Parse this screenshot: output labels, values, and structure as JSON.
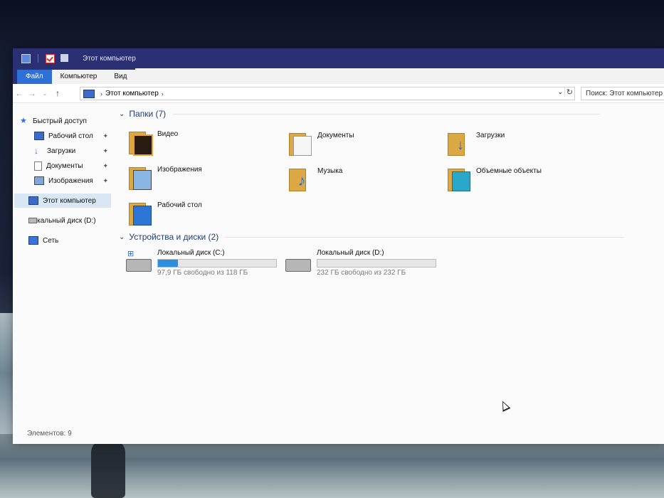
{
  "window": {
    "title": "Этот компьютер"
  },
  "ribbon": {
    "tabs": [
      "Файл",
      "Компьютер",
      "Вид"
    ]
  },
  "address": {
    "path": "Этот компьютер"
  },
  "search": {
    "placeholder": "Поиск: Этот компьютер"
  },
  "nav_pane": {
    "items": [
      {
        "label": "Быстрый доступ",
        "icon": "star-icon"
      },
      {
        "label": "Рабочий стол",
        "icon": "desktop-icon",
        "pinned": true
      },
      {
        "label": "Загрузки",
        "icon": "download-icon",
        "pinned": true
      },
      {
        "label": "Документы",
        "icon": "document-icon",
        "pinned": true
      },
      {
        "label": "Изображения",
        "icon": "image-icon",
        "pinned": true
      },
      {
        "label": "Этот компьютер",
        "icon": "computer-icon",
        "selected": true
      },
      {
        "label": "Локальный диск (D:)",
        "icon": "drive-icon"
      },
      {
        "label": "Сеть",
        "icon": "network-icon"
      }
    ]
  },
  "folders_group": {
    "title": "Папки (7)",
    "items": [
      {
        "label": "Видео",
        "icon": "video-folder-icon"
      },
      {
        "label": "Документы",
        "icon": "documents-folder-icon"
      },
      {
        "label": "Загрузки",
        "icon": "downloads-folder-icon"
      },
      {
        "label": "Изображения",
        "icon": "pictures-folder-icon"
      },
      {
        "label": "Музыка",
        "icon": "music-folder-icon"
      },
      {
        "label": "Объемные объекты",
        "icon": "3d-objects-folder-icon"
      },
      {
        "label": "Рабочий стол",
        "icon": "desktop-folder-icon"
      }
    ]
  },
  "drives_group": {
    "title": "Устройства и диски (2)",
    "items": [
      {
        "label": "Локальный диск (C:)",
        "free": "97,9 ГБ свободно из 118 ГБ",
        "used_fraction": 0.17,
        "system": true
      },
      {
        "label": "Локальный диск (D:)",
        "free": "232 ГБ свободно из 232 ГБ",
        "used_fraction": 0.0,
        "system": false
      }
    ]
  },
  "status_bar": {
    "items_count": "Элементов: 9"
  }
}
